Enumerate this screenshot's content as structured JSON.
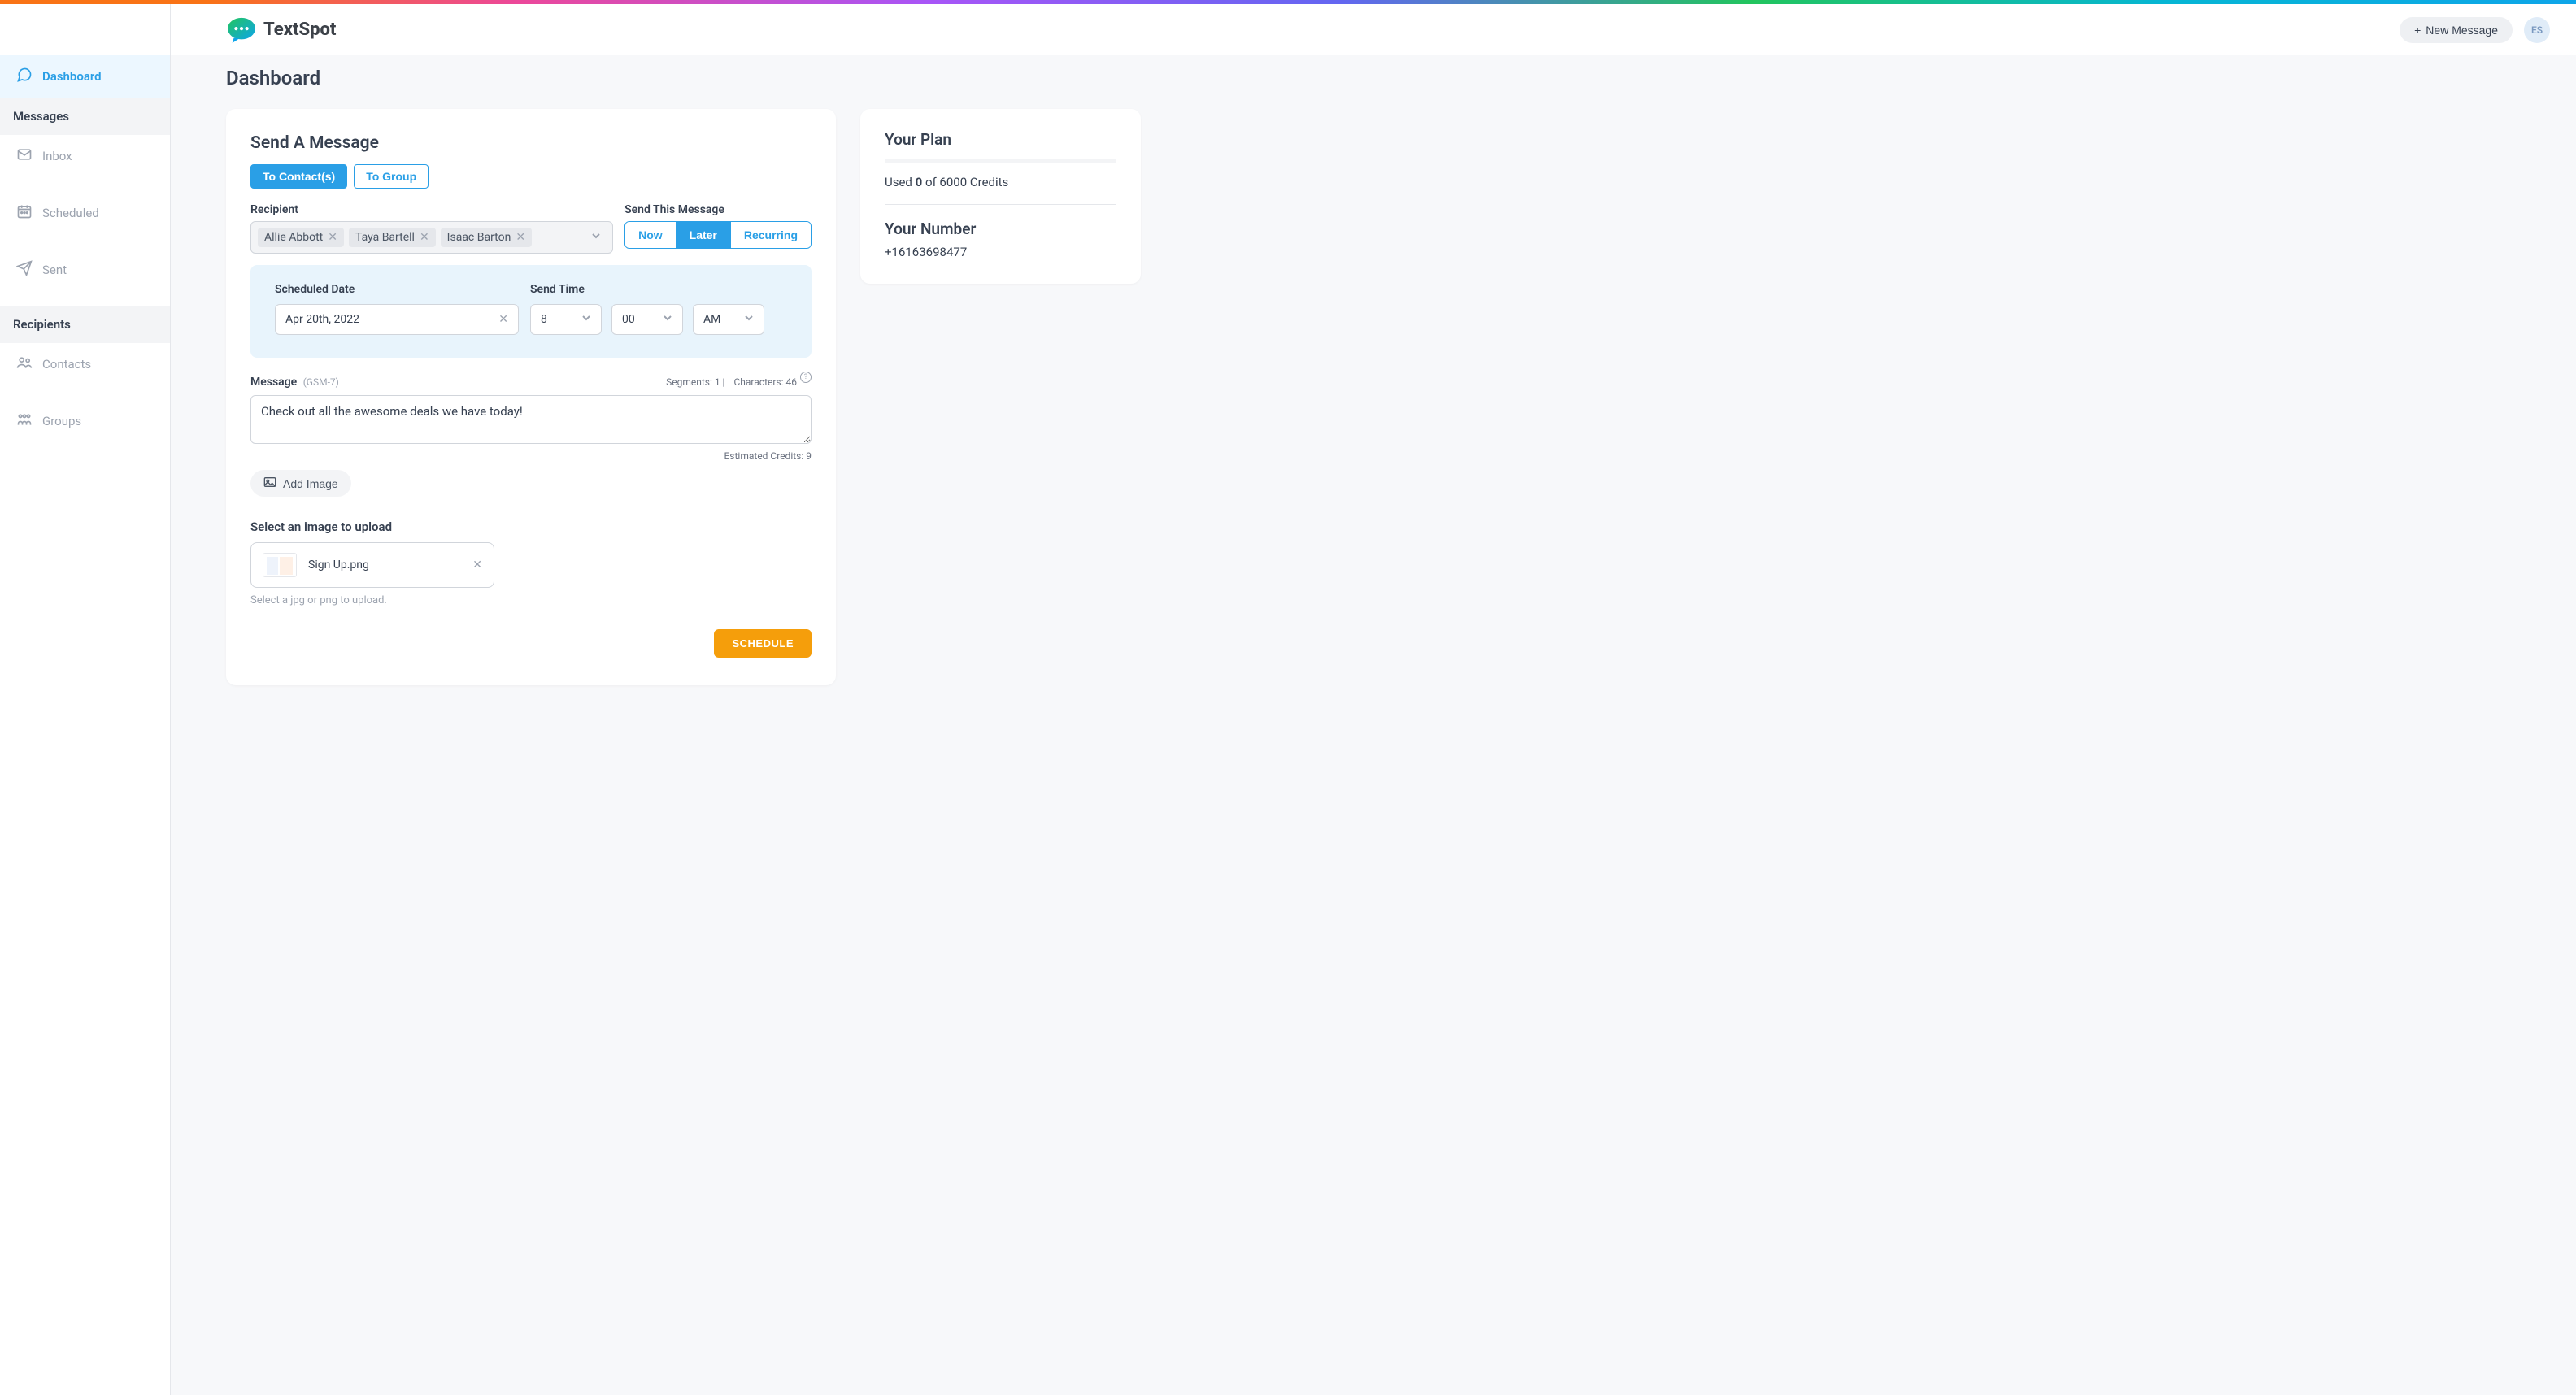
{
  "brand": {
    "name": "TextSpot"
  },
  "topbar": {
    "new_message_label": "New Message",
    "avatar_initials": "ES"
  },
  "sidebar": {
    "items": [
      {
        "label": "Dashboard"
      }
    ],
    "section_messages": "Messages",
    "msg_items": [
      {
        "label": "Inbox"
      },
      {
        "label": "Scheduled"
      },
      {
        "label": "Sent"
      }
    ],
    "section_recipients": "Recipients",
    "recip_items": [
      {
        "label": "Contacts"
      },
      {
        "label": "Groups"
      }
    ]
  },
  "page": {
    "title": "Dashboard"
  },
  "form": {
    "title": "Send A Message",
    "tabs": {
      "to_contacts": "To Contact(s)",
      "to_group": "To Group"
    },
    "recipient_label": "Recipient",
    "recipients": [
      {
        "name": "Allie Abbott"
      },
      {
        "name": "Taya Bartell"
      },
      {
        "name": "Isaac Barton"
      }
    ],
    "send_timing_label": "Send This Message",
    "timing": {
      "now": "Now",
      "later": "Later",
      "recurring": "Recurring"
    },
    "scheduled_date_label": "Scheduled Date",
    "scheduled_date": "Apr 20th, 2022",
    "send_time_label": "Send Time",
    "hour": "8",
    "minute": "00",
    "ampm": "AM",
    "message_label": "Message",
    "message_encoding": "(GSM-7)",
    "segments_label": "Segments: 1 |",
    "characters_label": "Characters: 46",
    "message_text": "Check out all the awesome deals we have today!",
    "estimated_credits": "Estimated Credits: 9",
    "add_image_label": "Add Image",
    "upload_title": "Select an image to upload",
    "file_name": "Sign Up.png",
    "upload_hint": "Select a jpg or png to upload.",
    "submit_label": "SCHEDULE"
  },
  "plan": {
    "title": "Your Plan",
    "used_prefix": "Used ",
    "used_value": "0",
    "used_suffix": " of 6000 Credits",
    "number_title": "Your Number",
    "phone": "+16163698477"
  }
}
